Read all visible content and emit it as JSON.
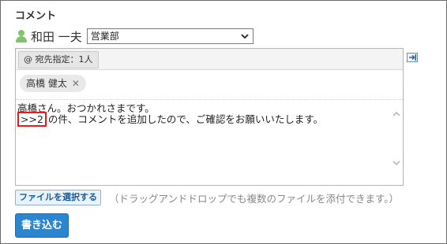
{
  "section": {
    "title": "コメント"
  },
  "author": {
    "name": "和田 一夫",
    "icon": "user-icon"
  },
  "department_select": {
    "selected": "営業部"
  },
  "editor": {
    "mention_button_label": "@ 宛先指定：1人",
    "recipients": [
      {
        "label": "高橋 健太"
      }
    ],
    "body": {
      "line1": "高橋さん。おつかれさまです。",
      "quote_ref": ">>2",
      "line2_rest": "の件、コメントを追加したので、ご確認をお願いいたします。"
    }
  },
  "attachments": {
    "select_button_label": "ファイルを選択する",
    "hint": "（ドラッグアンドドロップでも複数のファイルを添付できます。）"
  },
  "actions": {
    "submit_label": "書き込む"
  },
  "colors": {
    "accent": "#2b86cf",
    "highlight_border": "#e02020",
    "user_icon": "#7fc36b"
  }
}
